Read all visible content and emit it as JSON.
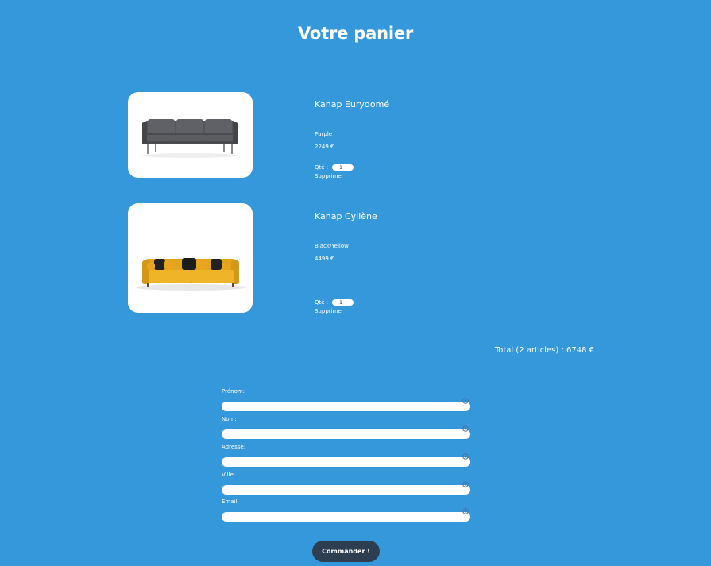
{
  "page": {
    "title": "Votre panier"
  },
  "cart": {
    "items": [
      {
        "name": "Kanap Eurydomé",
        "color": "Purple",
        "price": "2249 €",
        "qty_label": "Qté :",
        "quantity": "1",
        "delete_label": "Supprimer",
        "image_icon": "grey-sofa-image"
      },
      {
        "name": "Kanap Cyllène",
        "color": "Black/Yellow",
        "price": "4499 €",
        "qty_label": "Qté :",
        "quantity": "1",
        "delete_label": "Supprimer",
        "image_icon": "yellow-sofa-image"
      }
    ],
    "total": "Total (2 articles) : 6748 €"
  },
  "form": {
    "fields": [
      {
        "label": "Prénom:",
        "value": ""
      },
      {
        "label": "Nom:",
        "value": ""
      },
      {
        "label": "Adresse:",
        "value": ""
      },
      {
        "label": "Ville:",
        "value": ""
      },
      {
        "label": "Email:",
        "value": ""
      }
    ],
    "field_icon": "autofill-arrow-icon",
    "submit_label": "Commander !"
  },
  "colors": {
    "background": "#3498db",
    "button": "#2c3e50",
    "text": "#ffffff"
  }
}
